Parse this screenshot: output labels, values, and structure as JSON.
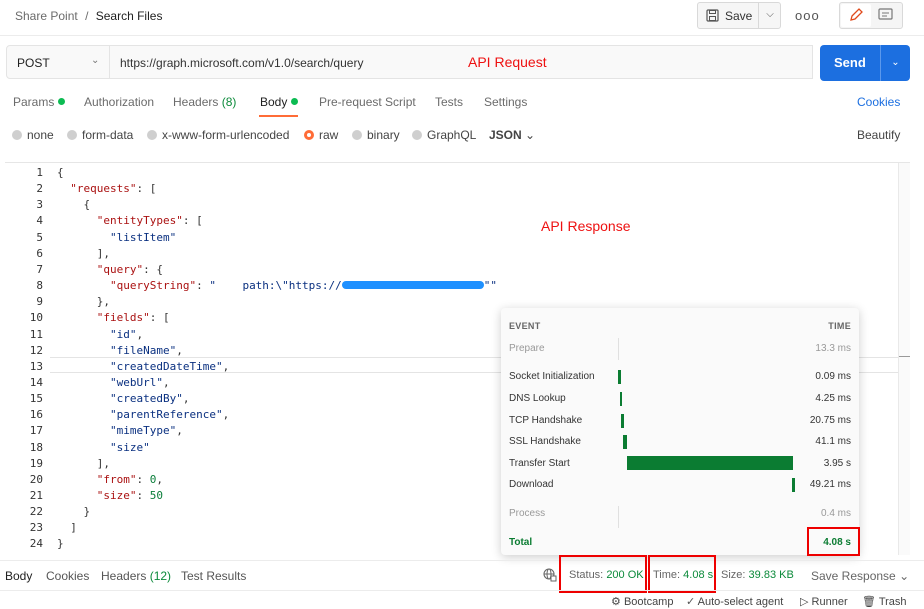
{
  "header": {
    "breadcrumb_parent": "Share Point",
    "breadcrumb_sep": "/",
    "breadcrumb_current": "Search Files",
    "save_label": "Save",
    "more_label": "ooo"
  },
  "request": {
    "method": "POST",
    "url": "https://graph.microsoft.com/v1.0/search/query",
    "annotation": "API Request",
    "send_label": "Send"
  },
  "tabs": {
    "items": [
      "Params",
      "Authorization",
      "Headers",
      "Body",
      "Pre-request Script",
      "Tests",
      "Settings"
    ],
    "headers_count": "(8)",
    "cookies_label": "Cookies"
  },
  "body_types": {
    "items": [
      "none",
      "form-data",
      "x-www-form-urlencoded",
      "raw",
      "binary",
      "GraphQL"
    ],
    "format": "JSON",
    "beautify_label": "Beautify"
  },
  "editor": {
    "annotation": "API Response",
    "line_numbers": [
      "1",
      "2",
      "3",
      "4",
      "5",
      "6",
      "7",
      "8",
      "9",
      "10",
      "11",
      "12",
      "13",
      "14",
      "15",
      "16",
      "17",
      "18",
      "19",
      "20",
      "21",
      "22",
      "23",
      "24"
    ]
  },
  "timing": {
    "event_header": "EVENT",
    "time_header": "TIME",
    "rows": [
      {
        "event": "Prepare",
        "time": "13.3 ms"
      },
      {
        "event": "Socket Initialization",
        "time": "0.09 ms"
      },
      {
        "event": "DNS Lookup",
        "time": "4.25 ms"
      },
      {
        "event": "TCP Handshake",
        "time": "20.75 ms"
      },
      {
        "event": "SSL Handshake",
        "time": "41.1 ms"
      },
      {
        "event": "Transfer Start",
        "time": "3.95 s"
      },
      {
        "event": "Download",
        "time": "49.21 ms"
      },
      {
        "event": "Process",
        "time": "0.4 ms"
      }
    ],
    "total_label": "Total",
    "total_value": "4.08 s"
  },
  "response_tabs": {
    "items": [
      "Body",
      "Cookies",
      "Headers",
      "Test Results"
    ],
    "headers_count": "(12)",
    "status_label": "Status:",
    "status_value": "200 OK",
    "time_label": "Time:",
    "time_value": "4.08 s",
    "size_label": "Size:",
    "size_value": "39.83 KB",
    "save_response_label": "Save Response"
  },
  "statusbar": {
    "bootcamp": "Bootcamp",
    "agent": "Auto-select agent",
    "runner": "Runner",
    "trash": "Trash"
  },
  "colors": {
    "accent": "#1c6fe0",
    "active_tab": "#ff6c37",
    "ok_green": "#0b7c32",
    "annotation_red": "#e11111"
  }
}
